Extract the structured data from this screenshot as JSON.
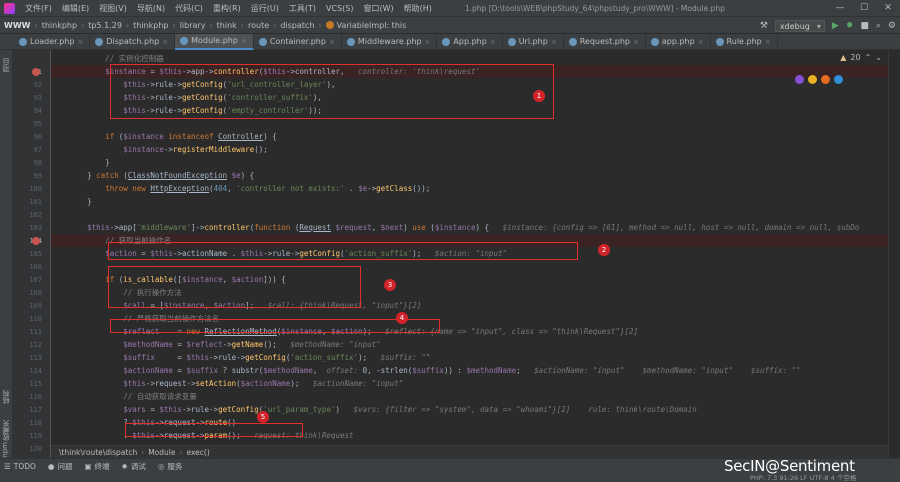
{
  "menu": {
    "items": [
      "文件(F)",
      "编辑(E)",
      "视图(V)",
      "导航(N)",
      "代码(C)",
      "重构(R)",
      "运行(U)",
      "工具(T)",
      "VCS(S)",
      "窗口(W)",
      "帮助(H)"
    ],
    "window_title": "1.php [D:\\tools\\WEB\\phpStudy_64\\phpstudy_pro\\WWW] - Module.php"
  },
  "breadcrumb": [
    "WWW",
    "thinkphp",
    "tp5.1.29",
    "thinkphp",
    "library",
    "think",
    "route",
    "dispatch",
    "VariableImpl: this"
  ],
  "run_config": "xdebug",
  "tabs": [
    "Loader.php",
    "Dispatch.php",
    "Module.php",
    "Container.php",
    "Middleware.php",
    "App.php",
    "Url.php",
    "Request.php",
    "app.php",
    "Rule.php"
  ],
  "active_tab": "Module.php",
  "warnings_count": "20",
  "line_numbers": [
    "",
    "91",
    "92",
    "93",
    "94",
    "95",
    "96",
    "97",
    "98",
    "99",
    "100",
    "101",
    "102",
    "103",
    "104",
    "105",
    "106",
    "107",
    "108",
    "109",
    "110",
    "111",
    "112",
    "113",
    "114",
    "115",
    "116",
    "117",
    "118",
    "119",
    "120"
  ],
  "breakpoint_lines": [
    "91",
    "104"
  ],
  "code_lines": [
    [
      [
        "cm",
        "            // 实例化控制器"
      ]
    ],
    [
      [
        "ph",
        "            "
      ],
      [
        "var",
        "$instance"
      ],
      [
        "ph",
        " = "
      ],
      [
        "var",
        "$this"
      ],
      [
        "ph",
        "->app->"
      ],
      [
        "fn",
        "controller"
      ],
      [
        "ph",
        "("
      ],
      [
        "var",
        "$this"
      ],
      [
        "ph",
        "->controller,  "
      ],
      [
        "hint",
        " controller: 'think\\request'"
      ]
    ],
    [
      [
        "ph",
        "                "
      ],
      [
        "var",
        "$this"
      ],
      [
        "ph",
        "->rule->"
      ],
      [
        "fn",
        "getConfig"
      ],
      [
        "ph",
        "("
      ],
      [
        "str",
        "'url_controller_layer'"
      ],
      [
        "ph",
        "),"
      ]
    ],
    [
      [
        "ph",
        "                "
      ],
      [
        "var",
        "$this"
      ],
      [
        "ph",
        "->rule->"
      ],
      [
        "fn",
        "getConfig"
      ],
      [
        "ph",
        "("
      ],
      [
        "str",
        "'controller_suffix'"
      ],
      [
        "ph",
        "),"
      ]
    ],
    [
      [
        "ph",
        "                "
      ],
      [
        "var",
        "$this"
      ],
      [
        "ph",
        "->rule->"
      ],
      [
        "fn",
        "getConfig"
      ],
      [
        "ph",
        "("
      ],
      [
        "str",
        "'empty_controller'"
      ],
      [
        "ph",
        "));"
      ]
    ],
    [
      [
        "ph",
        ""
      ]
    ],
    [
      [
        "ph",
        "            "
      ],
      [
        "kw",
        "if"
      ],
      [
        "ph",
        " ("
      ],
      [
        "var",
        "$instance"
      ],
      [
        "ph",
        " "
      ],
      [
        "kw",
        "instanceof"
      ],
      [
        "ph",
        " "
      ],
      [
        "cls",
        "Controller"
      ],
      [
        "ph",
        ") {"
      ]
    ],
    [
      [
        "ph",
        "                "
      ],
      [
        "var",
        "$instance"
      ],
      [
        "ph",
        "->"
      ],
      [
        "fn",
        "registerMiddleware"
      ],
      [
        "ph",
        "();"
      ]
    ],
    [
      [
        "ph",
        "            }"
      ]
    ],
    [
      [
        "ph",
        "        } "
      ],
      [
        "kw",
        "catch"
      ],
      [
        "ph",
        " ("
      ],
      [
        "cls",
        "ClassNotFoundException"
      ],
      [
        "ph",
        " "
      ],
      [
        "var",
        "$e"
      ],
      [
        "ph",
        ") {"
      ]
    ],
    [
      [
        "ph",
        "            "
      ],
      [
        "kw",
        "throw new"
      ],
      [
        "ph",
        " "
      ],
      [
        "cls",
        "HttpException"
      ],
      [
        "ph",
        "("
      ],
      [
        "num",
        "404"
      ],
      [
        "ph",
        ", "
      ],
      [
        "str",
        "'controller not exists:'"
      ],
      [
        "ph",
        " . "
      ],
      [
        "var",
        "$e"
      ],
      [
        "ph",
        "->"
      ],
      [
        "fn",
        "getClass"
      ],
      [
        "ph",
        "());"
      ]
    ],
    [
      [
        "ph",
        "        }"
      ]
    ],
    [
      [
        "ph",
        ""
      ]
    ],
    [
      [
        "ph",
        "        "
      ],
      [
        "var",
        "$this"
      ],
      [
        "ph",
        "->app["
      ],
      [
        "str",
        "'middleware'"
      ],
      [
        "ph",
        "]->"
      ],
      [
        "fn",
        "controller"
      ],
      [
        "ph",
        "("
      ],
      [
        "kw",
        "function"
      ],
      [
        "ph",
        " ("
      ],
      [
        "cls",
        "Request"
      ],
      [
        "ph",
        " "
      ],
      [
        "var",
        "$request"
      ],
      [
        "ph",
        ", "
      ],
      [
        "var",
        "$next"
      ],
      [
        "ph",
        ") "
      ],
      [
        "kw",
        "use"
      ],
      [
        "ph",
        " ("
      ],
      [
        "var",
        "$instance"
      ],
      [
        "ph",
        ") {   "
      ],
      [
        "hint",
        "$instance: {config => [61], method => null, host => null, domain => null, subDo"
      ]
    ],
    [
      [
        "cm",
        "            // 获取当前操作名"
      ]
    ],
    [
      [
        "ph",
        "            "
      ],
      [
        "var",
        "$action"
      ],
      [
        "ph",
        " = "
      ],
      [
        "var",
        "$this"
      ],
      [
        "ph",
        "->actionName . "
      ],
      [
        "var",
        "$this"
      ],
      [
        "ph",
        "->rule->"
      ],
      [
        "fn",
        "getConfig"
      ],
      [
        "ph",
        "("
      ],
      [
        "str",
        "'action_suffix'"
      ],
      [
        "ph",
        ");   "
      ],
      [
        "hint",
        "$action: \"input\""
      ]
    ],
    [
      [
        "ph",
        ""
      ]
    ],
    [
      [
        "ph",
        "            "
      ],
      [
        "kw",
        "if"
      ],
      [
        "ph",
        " ("
      ],
      [
        "fn",
        "is_callable"
      ],
      [
        "ph",
        "(["
      ],
      [
        "var",
        "$instance"
      ],
      [
        "ph",
        ", "
      ],
      [
        "var",
        "$action"
      ],
      [
        "ph",
        "])) {"
      ]
    ],
    [
      [
        "cm",
        "                // 执行操作方法"
      ]
    ],
    [
      [
        "ph",
        "                "
      ],
      [
        "var",
        "$call"
      ],
      [
        "ph",
        " = ["
      ],
      [
        "var",
        "$instance"
      ],
      [
        "ph",
        ", "
      ],
      [
        "var",
        "$action"
      ],
      [
        "ph",
        "];   "
      ],
      [
        "hint",
        "$call: {think\\Request, \"input\"}[2]"
      ]
    ],
    [
      [
        "cm",
        "                // 严格获取当前操作方法名"
      ]
    ],
    [
      [
        "ph",
        "                "
      ],
      [
        "var",
        "$reflect"
      ],
      [
        "ph",
        "    = "
      ],
      [
        "kw",
        "new"
      ],
      [
        "ph",
        " "
      ],
      [
        "cls",
        "ReflectionMethod"
      ],
      [
        "ph",
        "("
      ],
      [
        "var",
        "$instance"
      ],
      [
        "ph",
        ", "
      ],
      [
        "var",
        "$action"
      ],
      [
        "ph",
        ");   "
      ],
      [
        "hint",
        "$reflect: {name => \"input\", class => \"think\\Request\"}[2]"
      ]
    ],
    [
      [
        "ph",
        "                "
      ],
      [
        "var",
        "$methodName"
      ],
      [
        "ph",
        " = "
      ],
      [
        "var",
        "$reflect"
      ],
      [
        "ph",
        "->"
      ],
      [
        "fn",
        "getName"
      ],
      [
        "ph",
        "();   "
      ],
      [
        "hint",
        "$methodName: \"input\""
      ]
    ],
    [
      [
        "ph",
        "                "
      ],
      [
        "var",
        "$suffix"
      ],
      [
        "ph",
        "     = "
      ],
      [
        "var",
        "$this"
      ],
      [
        "ph",
        "->rule->"
      ],
      [
        "fn",
        "getConfig"
      ],
      [
        "ph",
        "("
      ],
      [
        "str",
        "'action_suffix'"
      ],
      [
        "ph",
        ");   "
      ],
      [
        "hint",
        "$suffix: \"\""
      ]
    ],
    [
      [
        "ph",
        "                "
      ],
      [
        "var",
        "$actionName"
      ],
      [
        "ph",
        " = "
      ],
      [
        "var",
        "$suffix"
      ],
      [
        "ph",
        " ? substr("
      ],
      [
        "var",
        "$methodName"
      ],
      [
        "ph",
        ",  "
      ],
      [
        "hint",
        "offset:"
      ],
      [
        "ph",
        " 0, -strlen("
      ],
      [
        "var",
        "$suffix"
      ],
      [
        "ph",
        ")) : "
      ],
      [
        "var",
        "$methodName"
      ],
      [
        "ph",
        ";   "
      ],
      [
        "hint",
        "$actionName: \"input\"    $methodName: \"input\"    $suffix: \"\""
      ]
    ],
    [
      [
        "ph",
        "                "
      ],
      [
        "var",
        "$this"
      ],
      [
        "ph",
        "->request->"
      ],
      [
        "fn",
        "setAction"
      ],
      [
        "ph",
        "("
      ],
      [
        "var",
        "$actionName"
      ],
      [
        "ph",
        ");   "
      ],
      [
        "hint",
        "$actionName: \"input\""
      ]
    ],
    [
      [
        "cm",
        "                // 自动获取请求变量"
      ]
    ],
    [
      [
        "ph",
        "                "
      ],
      [
        "var",
        "$vars"
      ],
      [
        "ph",
        " = "
      ],
      [
        "var",
        "$this"
      ],
      [
        "ph",
        "->rule->"
      ],
      [
        "fn",
        "getConfig"
      ],
      [
        "ph",
        "("
      ],
      [
        "str",
        "'url_param_type'"
      ],
      [
        "ph",
        ")   "
      ],
      [
        "hint",
        "$vars: {filter => \"system\", data => \"whoami\"}[2]    rule: think\\route\\Domain"
      ]
    ],
    [
      [
        "ph",
        "                ? "
      ],
      [
        "var",
        "$this"
      ],
      [
        "ph",
        "->request->"
      ],
      [
        "fn",
        "route"
      ],
      [
        "ph",
        "()"
      ]
    ],
    [
      [
        "ph",
        "                : "
      ],
      [
        "var",
        "$this"
      ],
      [
        "ph",
        "->request->"
      ],
      [
        "fn",
        "param"
      ],
      [
        "ph",
        "();   "
      ],
      [
        "hint",
        "request: think\\Request"
      ]
    ],
    [
      [
        "ph",
        "                "
      ],
      [
        "var",
        "$vars"
      ],
      [
        "ph",
        " = "
      ],
      [
        "fn",
        "array_merge"
      ],
      [
        "ph",
        "("
      ],
      [
        "var",
        "$vars"
      ],
      [
        "ph",
        ", "
      ],
      [
        "var",
        "$this"
      ],
      [
        "ph",
        "->param);   "
      ],
      [
        "hint",
        "param: [0]"
      ]
    ]
  ],
  "annotations": [
    "1",
    "2",
    "3",
    "4",
    "5"
  ],
  "bottom_breadcrumb": [
    "\\think\\route\\dispatch",
    "Module",
    "exec()"
  ],
  "tool_windows": {
    "left": [
      "项目",
      "结构",
      "收藏夹",
      "npm"
    ],
    "bottom": [
      "TODO",
      "问题",
      "终端",
      "调试",
      "服务"
    ]
  },
  "status_info": "PHP: 7.3  91:26  LF  UTF-8  4 个空格",
  "watermark": "SecIN@Sentiment",
  "colors": {
    "keyword": "#cc7832",
    "variable": "#9876aa",
    "function": "#ffc66d",
    "string": "#6a8759",
    "comment": "#808080",
    "annotation": "#e0302b"
  }
}
